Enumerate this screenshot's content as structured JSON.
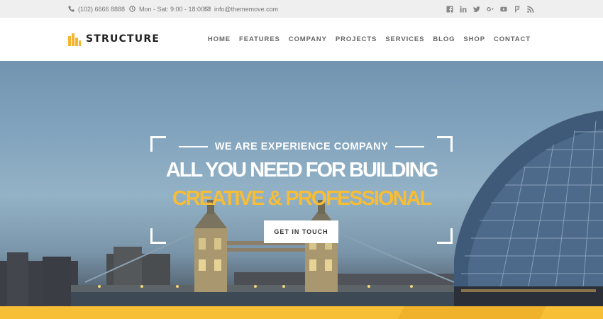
{
  "topbar": {
    "phone": "(102) 6666 8888",
    "hours": "Mon - Sat: 9:00 - 18:00",
    "email": "info@thememove.com",
    "social_icons": [
      "facebook-icon",
      "linkedin-icon",
      "twitter-icon",
      "google-plus-icon",
      "youtube-icon",
      "foursquare-icon",
      "rss-icon"
    ]
  },
  "header": {
    "logo_text": "STRUCTURE",
    "nav": [
      "HOME",
      "FEATURES",
      "COMPANY",
      "PROJECTS",
      "SERVICES",
      "BLOG",
      "SHOP",
      "CONTACT"
    ]
  },
  "hero": {
    "eyebrow": "WE ARE EXPERIENCE COMPANY",
    "headline": "ALL YOU NEED FOR BUILDING",
    "subheadline": "CREATIVE & PROFESSIONAL",
    "cta": "GET IN TOUCH"
  },
  "colors": {
    "accent": "#f7bd36",
    "topbar_bg": "#efefef",
    "nav_text": "#666666"
  }
}
